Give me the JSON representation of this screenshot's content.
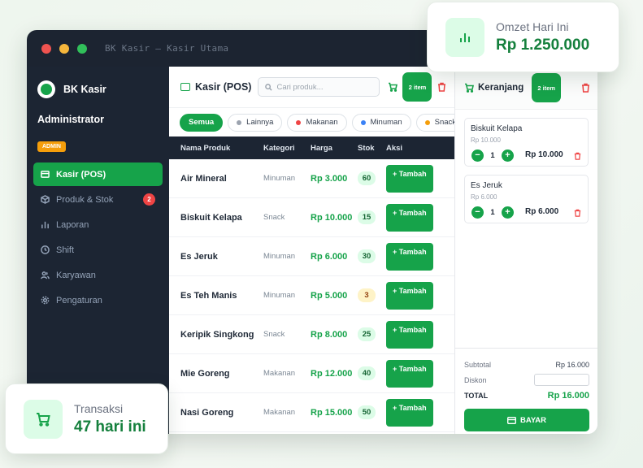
{
  "window": {
    "title": "BK Kasir — Kasir Utama",
    "controls": {
      "close_color": "#ef5350",
      "minimize_color": "#f6b73c",
      "zoom_color": "#31c05a"
    }
  },
  "sidebar": {
    "brand": "BK Kasir",
    "user": "Administrator",
    "role": "ADMIN",
    "items": [
      {
        "label": "Kasir (POS)",
        "icon": "register-icon",
        "active": true
      },
      {
        "label": "Produk & Stok",
        "icon": "box-icon",
        "badge": "2"
      },
      {
        "label": "Laporan",
        "icon": "chart-icon"
      },
      {
        "label": "Shift",
        "icon": "clock-icon"
      },
      {
        "label": "Karyawan",
        "icon": "users-icon"
      },
      {
        "label": "Pengaturan",
        "icon": "gear-icon"
      }
    ]
  },
  "header": {
    "title": "Kasir (POS)",
    "search_placeholder": "Cari produk...",
    "cart_count": "2 item"
  },
  "filters": [
    {
      "label": "Semua",
      "active": true
    },
    {
      "label": "Lainnya",
      "dot": "#9ca3af"
    },
    {
      "label": "Makanan",
      "dot": "#ef4444"
    },
    {
      "label": "Minuman",
      "dot": "#3b82f6"
    },
    {
      "label": "Snack",
      "dot": "#f59e0b"
    }
  ],
  "table": {
    "headers": [
      "Nama Produk",
      "Kategori",
      "Harga",
      "Stok",
      "Aksi"
    ],
    "add_label": "+ Tambah",
    "rows": [
      {
        "name": "Air Mineral",
        "category": "Minuman",
        "price": "Rp 3.000",
        "stock": "60"
      },
      {
        "name": "Biskuit Kelapa",
        "category": "Snack",
        "price": "Rp 10.000",
        "stock": "15"
      },
      {
        "name": "Es Jeruk",
        "category": "Minuman",
        "price": "Rp 6.000",
        "stock": "30"
      },
      {
        "name": "Es Teh Manis",
        "category": "Minuman",
        "price": "Rp 5.000",
        "stock": "3",
        "low": true
      },
      {
        "name": "Keripik Singkong",
        "category": "Snack",
        "price": "Rp 8.000",
        "stock": "25"
      },
      {
        "name": "Mie Goreng",
        "category": "Makanan",
        "price": "Rp 12.000",
        "stock": "40"
      },
      {
        "name": "Nasi Goreng",
        "category": "Makanan",
        "price": "Rp 15.000",
        "stock": "50"
      }
    ]
  },
  "cart": {
    "title": "Keranjang",
    "count": "2 item",
    "items": [
      {
        "name": "Biskuit Kelapa",
        "unit_price": "Rp 10.000",
        "qty": "1",
        "total": "Rp 10.000"
      },
      {
        "name": "Es Jeruk",
        "unit_price": "Rp 6.000",
        "qty": "1",
        "total": "Rp 6.000"
      }
    ],
    "subtotal_label": "Subtotal",
    "subtotal": "Rp 16.000",
    "discount_label": "Diskon",
    "discount_value": "",
    "total_label": "TOTAL",
    "total": "Rp 16.000",
    "pay_label": "BAYAR"
  },
  "cards": {
    "omzet": {
      "label": "Omzet Hari Ini",
      "value": "Rp 1.250.000",
      "icon": "bar-chart-icon"
    },
    "transaksi": {
      "label": "Transaksi",
      "value": "47 hari ini",
      "icon": "cart-icon"
    }
  },
  "colors": {
    "accent": "#16a34a",
    "sidebar": "#1c2533",
    "danger": "#ef4444"
  }
}
